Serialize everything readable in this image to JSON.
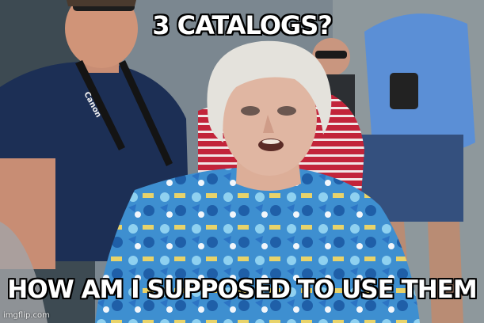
{
  "meme": {
    "top_text": "3 CATALOGS?",
    "bottom_text": "HOW AM I SUPPOSED TO USE THEM",
    "watermark": "imgflip.com",
    "camera_strap_text": "Canon"
  },
  "colors": {
    "caption_fill": "#ffffff",
    "caption_outline": "#000000",
    "shirt_blue": "#3e8fd0",
    "navy_shirt": "#1c2f55",
    "red_striped_shirt": "#c2243a",
    "hair_white": "#e4e2dc",
    "skin": "#e0b6a2"
  }
}
